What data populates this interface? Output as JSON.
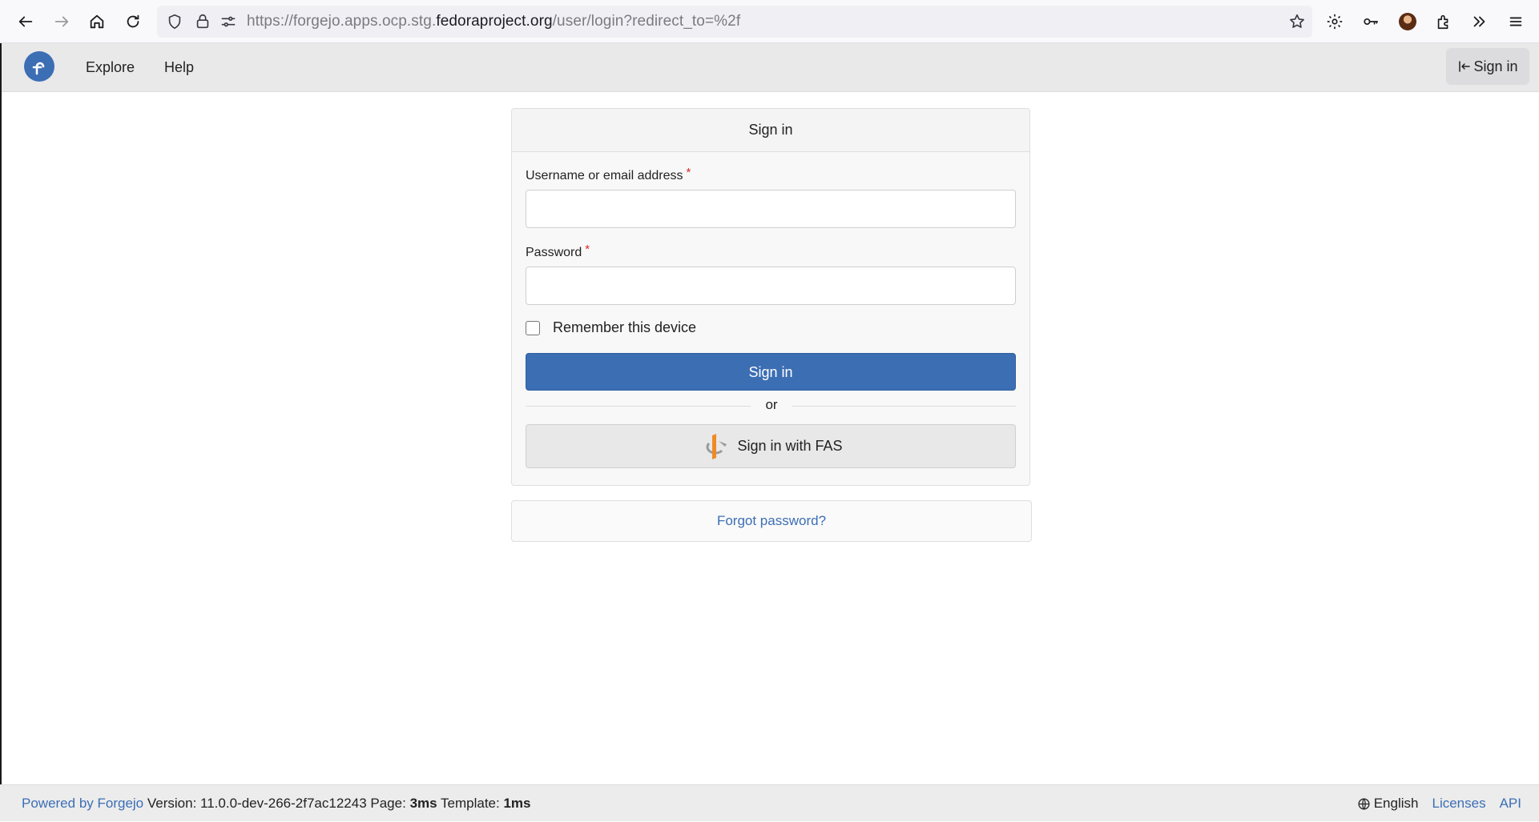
{
  "browser": {
    "url_prefix": "https://forgejo.apps.ocp.stg.",
    "url_host": "fedoraproject.org",
    "url_path": "/user/login?redirect_to=%2f",
    "icons": [
      "back-arrow-icon",
      "forward-arrow-icon",
      "home-icon",
      "reload-icon",
      "shield-icon",
      "lock-icon",
      "permissions-icon",
      "star-icon",
      "gear-icon",
      "key-icon",
      "avatar",
      "extensions-icon",
      "overflow-icon",
      "menu-icon"
    ]
  },
  "navbar": {
    "explore": "Explore",
    "help": "Help",
    "sign_in": "Sign in"
  },
  "login": {
    "title": "Sign in",
    "username_label": "Username or email address",
    "password_label": "Password",
    "required_mark": "*",
    "username_value": "",
    "password_value": "",
    "remember_label": "Remember this device",
    "remember_checked": false,
    "submit_label": "Sign in",
    "or_text": "or",
    "oauth_label": "Sign in with FAS",
    "forgot_label": "Forgot password?"
  },
  "footer": {
    "powered_by": "Powered by Forgejo",
    "version_text": "Version: 11.0.0-dev-266-2f7ac12243",
    "page_label": "Page:",
    "page_time": "3ms",
    "template_label": "Template:",
    "template_time": "1ms",
    "language": "English",
    "licenses": "Licenses",
    "api": "API"
  },
  "colors": {
    "primary": "#3c6eb4",
    "required": "#db2828",
    "fas_orange": "#f08a24"
  }
}
